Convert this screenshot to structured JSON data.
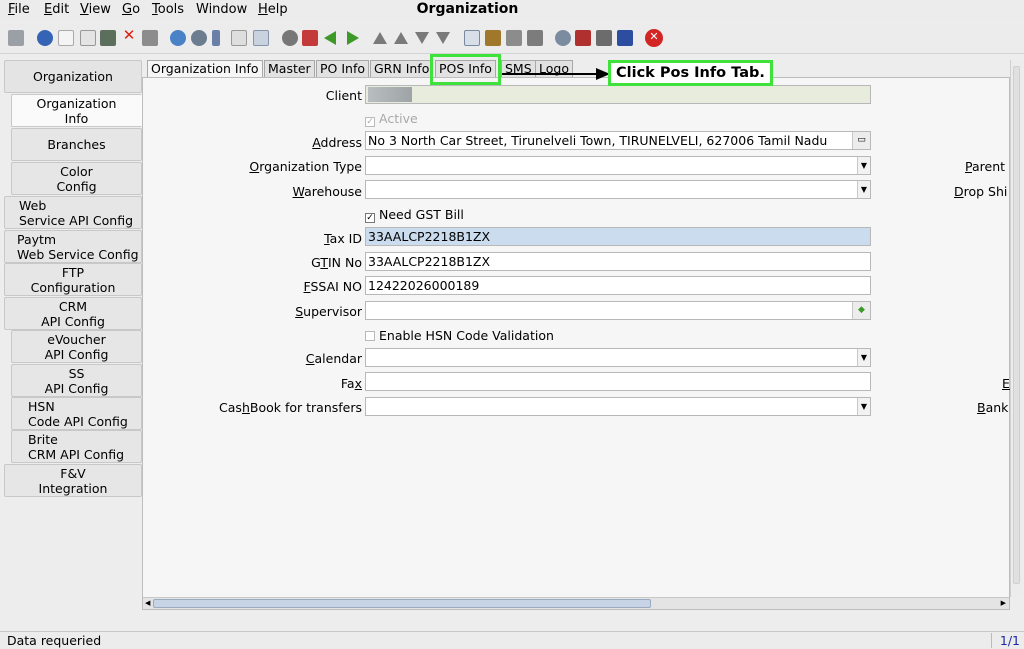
{
  "window": {
    "title": "Organization"
  },
  "menu": [
    {
      "label_u": "F",
      "label_rest": "ile"
    },
    {
      "label_u": "E",
      "label_rest": "dit"
    },
    {
      "label_u": "V",
      "label_rest": "iew"
    },
    {
      "label_u": "G",
      "label_rest": "o"
    },
    {
      "label_u": "T",
      "label_rest": "ools"
    },
    {
      "label_u": "",
      "label_rest": "Window"
    },
    {
      "label_u": "H",
      "label_rest": "elp"
    }
  ],
  "toolbar_icons": [
    "undo-icon",
    "help-icon",
    "new-icon",
    "copy-icon",
    "delete-icon",
    "delete-selection-icon",
    "save-icon",
    "refresh-icon",
    "find-icon",
    "attachment-icon",
    "chat-icon",
    "grid-toggle-icon",
    "history-icon",
    "home-icon",
    "previous-record-icon",
    "next-record-icon",
    "first-record-icon",
    "previous-page-icon",
    "next-page-icon",
    "last-record-icon",
    "report-icon",
    "archive-icon",
    "print-preview-icon",
    "print-icon",
    "zoom-across-icon",
    "workflow-icon",
    "product-info-icon",
    "request-icon",
    "exit-icon"
  ],
  "side_tabs": [
    {
      "lines": [
        "Organization"
      ]
    },
    {
      "lines": [
        "Organization",
        "Info"
      ]
    },
    {
      "lines": [
        "Branches"
      ]
    },
    {
      "lines": [
        "Color",
        "Config"
      ]
    },
    {
      "lines": [
        "Web",
        "Service API Config"
      ]
    },
    {
      "lines": [
        "Paytm",
        "Web Service Config"
      ]
    },
    {
      "lines": [
        "FTP",
        "Configuration"
      ]
    },
    {
      "lines": [
        "CRM",
        "API Config"
      ]
    },
    {
      "lines": [
        "eVoucher",
        "API Config"
      ]
    },
    {
      "lines": [
        "SS",
        "API Config"
      ]
    },
    {
      "lines": [
        "HSN",
        "Code API Config"
      ]
    },
    {
      "lines": [
        "Brite",
        "CRM API Config"
      ]
    },
    {
      "lines": [
        "F&V",
        "Integration"
      ]
    }
  ],
  "tabs": [
    "Organization Info",
    "Master",
    "PO Info",
    "GRN Info",
    "POS Info",
    "SMS",
    "Logo"
  ],
  "form": {
    "client_label": "Client",
    "active_label": "Active",
    "address_label_u": "A",
    "address_label_rest": "ddress",
    "address_value": "No 3 North Car Street, Tirunelveli Town, TIRUNELVELI,  627006 Tamil Nadu",
    "org_type_label_u": "O",
    "org_type_label_rest": "rganization Type",
    "org_type_value": "",
    "warehouse_label_u": "W",
    "warehouse_label_rest": "arehouse",
    "warehouse_value": "",
    "need_gst_label": "Need GST Bill",
    "tax_id_label_u": "T",
    "tax_id_label_rest": "ax ID",
    "tax_id_value": "33AALCP2218B1ZX",
    "gtin_label_pre": "G",
    "gtin_label_u": "T",
    "gtin_label_rest": "IN No",
    "gtin_value": "33AALCP2218B1ZX",
    "fssai_label_u": "F",
    "fssai_label_rest": "SSAI NO",
    "fssai_value": "12422026000189",
    "supervisor_label_u": "S",
    "supervisor_label_rest": "upervisor",
    "supervisor_value": "",
    "hsn_label": "Enable HSN Code Validation",
    "calendar_label_u": "C",
    "calendar_label_rest": "alendar",
    "calendar_value": "",
    "fax_label_pre": "Fa",
    "fax_label_u": "x",
    "fax_value": "",
    "cashbook_label_pre": "Cas",
    "cashbook_label_u": "h",
    "cashbook_label_rest": "Book for transfers",
    "cashbook_value": "",
    "right_parent_u": "P",
    "right_parent_rest": "arent",
    "right_drop_u": "D",
    "right_drop_rest": "rop Shi",
    "right_e": "E",
    "right_bank_u": "B",
    "right_bank_rest": "ank"
  },
  "annotation": {
    "callout_text": "Click Pos Info Tab."
  },
  "status": {
    "text": "Data requeried",
    "record_count": "1/1"
  },
  "colors": {
    "highlight": "#3ee23a",
    "taxid_bg": "#cbdcef",
    "client_bg": "#e8ecdd"
  }
}
